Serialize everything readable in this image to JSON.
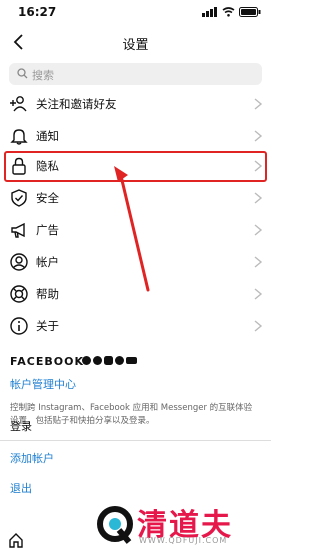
{
  "status": {
    "time": "16:27"
  },
  "header": {
    "title": "设置"
  },
  "search": {
    "placeholder": "搜索"
  },
  "menu": [
    {
      "label": "关注和邀请好友",
      "icon": "add-user-icon"
    },
    {
      "label": "通知",
      "icon": "bell-icon"
    },
    {
      "label": "隐私",
      "icon": "lock-icon"
    },
    {
      "label": "安全",
      "icon": "shield-icon"
    },
    {
      "label": "广告",
      "icon": "megaphone-icon"
    },
    {
      "label": "帐户",
      "icon": "account-icon"
    },
    {
      "label": "帮助",
      "icon": "lifebuoy-icon"
    },
    {
      "label": "关于",
      "icon": "info-icon"
    }
  ],
  "facebook": {
    "brand": "FACEBOOK",
    "accounts_center": "帐户管理中心",
    "description": "控制跨 Instagram、Facebook 应用和 Messenger 的互联体验设置，包括贴子和快拍分享以及登录。"
  },
  "login": {
    "heading": "登录",
    "add_account": "添加帐户",
    "logout": "退出"
  },
  "watermark": {
    "brand": "清道夫",
    "url": "WWW.QDFUJI.COM"
  },
  "colors": {
    "highlight": "#e02424",
    "link": "#1e7fd1",
    "watermark": "#e6184b"
  }
}
